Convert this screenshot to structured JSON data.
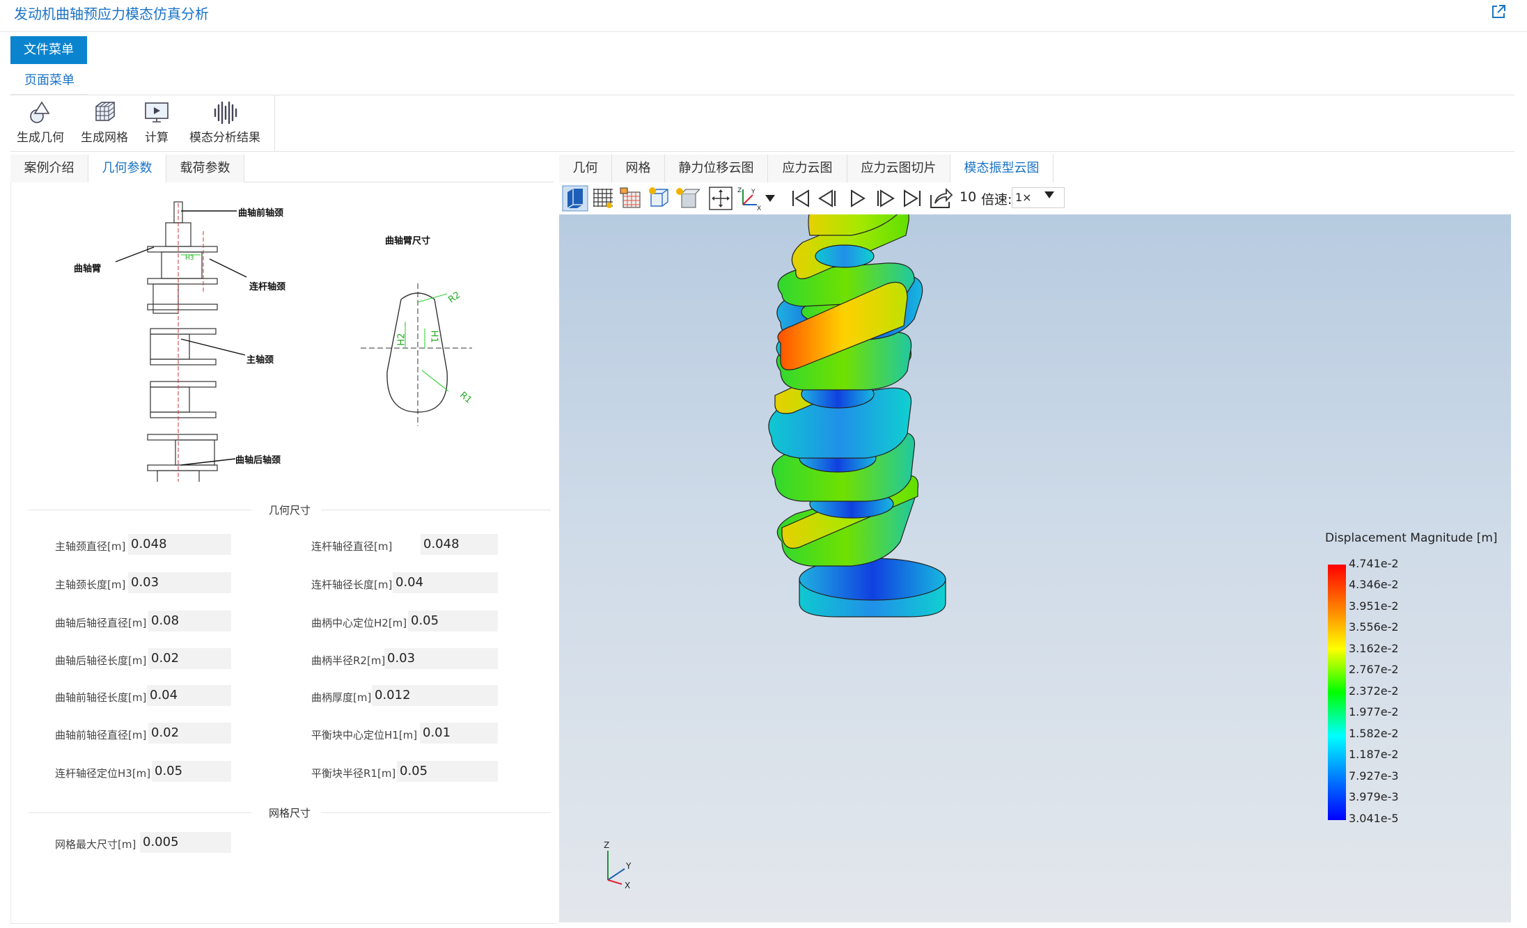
{
  "app_title": "发动机曲轴预应力模态仿真分析",
  "menu": {
    "file_menu": "文件菜单",
    "page_menu": "页面菜单"
  },
  "ribbon": {
    "items": [
      {
        "label": "生成几何",
        "icon": "geometry-icon"
      },
      {
        "label": "生成网格",
        "icon": "mesh-icon"
      },
      {
        "label": "计算",
        "icon": "compute-icon"
      },
      {
        "label": "模态分析结果",
        "icon": "modal-result-icon"
      }
    ]
  },
  "left_tabs": [
    {
      "label": "案例介绍",
      "active": false
    },
    {
      "label": "几何参数",
      "active": true
    },
    {
      "label": "载荷参数",
      "active": false
    }
  ],
  "diagram": {
    "front_journal": "曲轴前轴颈",
    "crank_arm": "曲轴臂",
    "rod_journal": "连杆轴颈",
    "main_journal": "主轴颈",
    "rear_journal": "曲轴后轴颈",
    "arm_dimensions": "曲轴臂尺寸",
    "h3": "H3",
    "r2": "R2",
    "h2": "H2",
    "h1": "H1",
    "r1": "R1"
  },
  "geometry_section": {
    "title": "几何尺寸",
    "fields": [
      {
        "label": "主轴颈直径[m]",
        "value": "0.048"
      },
      {
        "label": "连杆轴径直径[m]",
        "value": "0.048"
      },
      {
        "label": "主轴颈长度[m]",
        "value": "0.03"
      },
      {
        "label": "连杆轴径长度[m]",
        "value": "0.04"
      },
      {
        "label": "曲轴后轴径直径[m]",
        "value": "0.08"
      },
      {
        "label": "曲柄中心定位H2[m]",
        "value": "0.05"
      },
      {
        "label": "曲轴后轴径长度[m]",
        "value": "0.02"
      },
      {
        "label": "曲柄半径R2[m]",
        "value": "0.03"
      },
      {
        "label": "曲轴前轴径长度[m]",
        "value": "0.04"
      },
      {
        "label": "曲柄厚度[m]",
        "value": "0.012"
      },
      {
        "label": "曲轴前轴径直径[m]",
        "value": "0.02"
      },
      {
        "label": "平衡块中心定位H1[m]",
        "value": "0.01"
      },
      {
        "label": "连杆轴径定位H3[m]",
        "value": "0.05"
      },
      {
        "label": "平衡块半径R1[m]",
        "value": "0.05"
      }
    ]
  },
  "mesh_section": {
    "title": "网格尺寸",
    "fields": [
      {
        "label": "网格最大尺寸[m]",
        "value": "0.005"
      }
    ]
  },
  "right_tabs": [
    {
      "label": "几何",
      "active": false
    },
    {
      "label": "网格",
      "active": false
    },
    {
      "label": "静力位移云图",
      "active": false
    },
    {
      "label": "应力云图",
      "active": false
    },
    {
      "label": "应力云图切片",
      "active": false
    },
    {
      "label": "模态振型云图",
      "active": true
    }
  ],
  "toolbar": {
    "frame_count": "10",
    "speed_label": "倍速:",
    "speed_value": "1×",
    "icons": [
      "surface-view-icon",
      "wireframe-icon",
      "mesh-view-icon",
      "lighting-icon",
      "clip-icon",
      "light-bulb-icon",
      "fit-view-icon",
      "axis-orient-icon",
      "first-frame-icon",
      "prev-frame-icon",
      "play-icon",
      "next-frame-icon",
      "last-frame-icon",
      "export-icon"
    ]
  },
  "legend": {
    "title": "Displacement Magnitude [m]",
    "ticks": [
      "4.741e-2",
      "4.346e-2",
      "3.951e-2",
      "3.556e-2",
      "3.162e-2",
      "2.767e-2",
      "2.372e-2",
      "1.977e-2",
      "1.582e-2",
      "1.187e-2",
      "7.927e-3",
      "3.979e-3",
      "3.041e-5"
    ]
  },
  "axes": {
    "x": "X",
    "y": "Y",
    "z": "Z"
  },
  "colors": {
    "accent": "#0b84cf",
    "link": "#1a73c7"
  }
}
